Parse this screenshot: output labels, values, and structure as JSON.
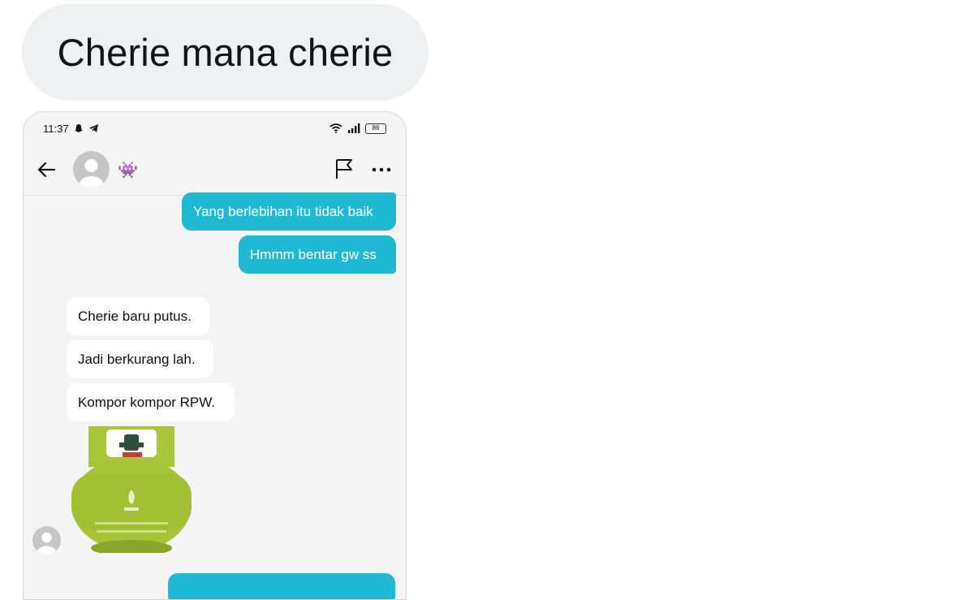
{
  "caption": {
    "text": "Cherie mana cherie"
  },
  "status_bar": {
    "time": "11:37",
    "battery": "86",
    "left_icons": [
      "snapchat-icon",
      "telegram-icon"
    ],
    "right_icons": [
      "wifi-icon",
      "signal-icon",
      "battery-icon"
    ]
  },
  "header": {
    "name_emoji": "👾",
    "icons": [
      "back-arrow-icon",
      "flag-icon",
      "more-icon"
    ]
  },
  "messages": [
    {
      "direction": "out",
      "text": "Yang berlebihan itu tidak baik"
    },
    {
      "direction": "out",
      "text": "Hmmm bentar gw ss"
    },
    {
      "direction": "in",
      "text": "Cherie baru putus."
    },
    {
      "direction": "in",
      "text": "Jadi berkurang lah."
    },
    {
      "direction": "in",
      "text": "Kompor kompor RPW."
    }
  ],
  "colors": {
    "outgoing_bubble": "#1fb9d3",
    "incoming_bubble": "#ffffff",
    "chat_background": "#f4f4f4",
    "caption_bubble": "#eef0f2",
    "gas_cylinder": "#a9c53a"
  }
}
